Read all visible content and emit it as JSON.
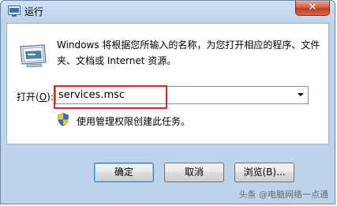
{
  "window": {
    "title": "运行",
    "close_label": "✕"
  },
  "dialog": {
    "description": "Windows 将根据您所输入的名称，为您打开相应的程序、文件夹、文档或 Internet 资源。",
    "open_label_prefix": "打开(",
    "open_label_key": "O",
    "open_label_suffix": "):",
    "open_value": "services.msc",
    "admin_note": "使用管理权限创建此任务。"
  },
  "buttons": {
    "ok": "确定",
    "cancel": "取消",
    "browse": "浏览(B)..."
  },
  "watermark": "头条 @电脑网络一点通",
  "colors": {
    "highlight": "#d7262b",
    "titlebar": "#cfe1f2"
  }
}
